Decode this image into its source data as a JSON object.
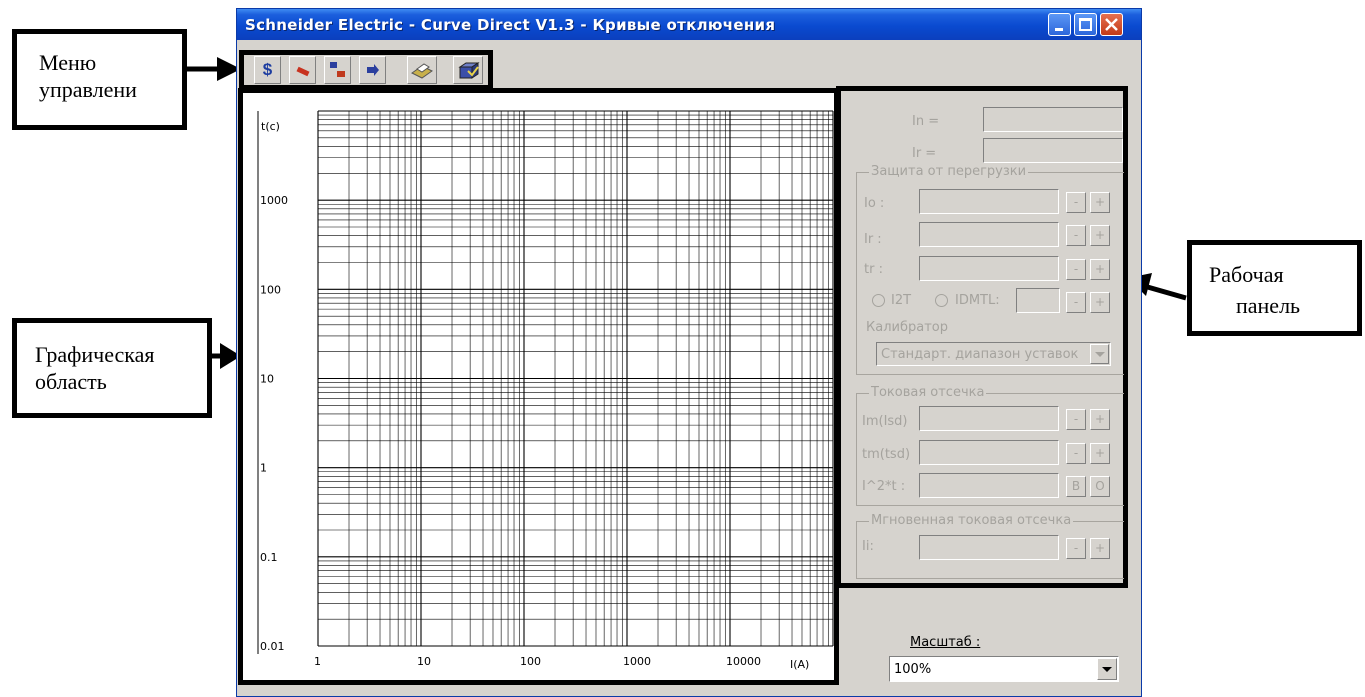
{
  "window": {
    "title": "Schneider Electric - Curve Direct V1.3 - Кривые отключения"
  },
  "callouts": {
    "menu": [
      "Меню",
      "управлени"
    ],
    "graphic": [
      "Графическая",
      "область"
    ],
    "panel": [
      "Рабочая",
      "панель"
    ]
  },
  "toolbar": {
    "icons": [
      "dollar-icon",
      "red-bar-icon",
      "arrows-icon",
      "arrow-icon",
      "print-icon",
      "export-icon"
    ]
  },
  "chart_data": {
    "type": "scatter",
    "title": "",
    "xlabel": "I(A)",
    "ylabel": "t(c)",
    "x_scale": "log",
    "y_scale": "log",
    "xlim": [
      1,
      100000
    ],
    "ylim": [
      0.01,
      10000
    ],
    "x_ticks": [
      "1",
      "10",
      "100",
      "1000",
      "10000"
    ],
    "y_ticks": [
      "1000",
      "100",
      "10",
      "1",
      "0.1",
      "0.01"
    ],
    "grid": true,
    "series": []
  },
  "panel": {
    "in_label": "In =",
    "ir_label": "Ir =",
    "overload": {
      "legend": "Защита от перегрузки",
      "io_label": "Io :",
      "ir_label": "Ir :",
      "tr_label": "tr :",
      "i2t_label": "I2T",
      "idmtl_label": "IDMTL:",
      "calibrator_label": "Калибратор",
      "calibrator_value": "Стандарт. диапазон уставок"
    },
    "short_time": {
      "legend": "Токовая отсечка",
      "im_label": "Im(Isd)",
      "tm_label": "tm(tsd)",
      "i2t_label": "I^2*t :",
      "b_button": "B",
      "o_button": "O"
    },
    "instant": {
      "legend": "Мгновенная токовая отсечка",
      "ii_label": "Ii:"
    },
    "minus": "-",
    "plus": "+"
  },
  "scale": {
    "label": "Масштаб :",
    "value": "100%"
  }
}
